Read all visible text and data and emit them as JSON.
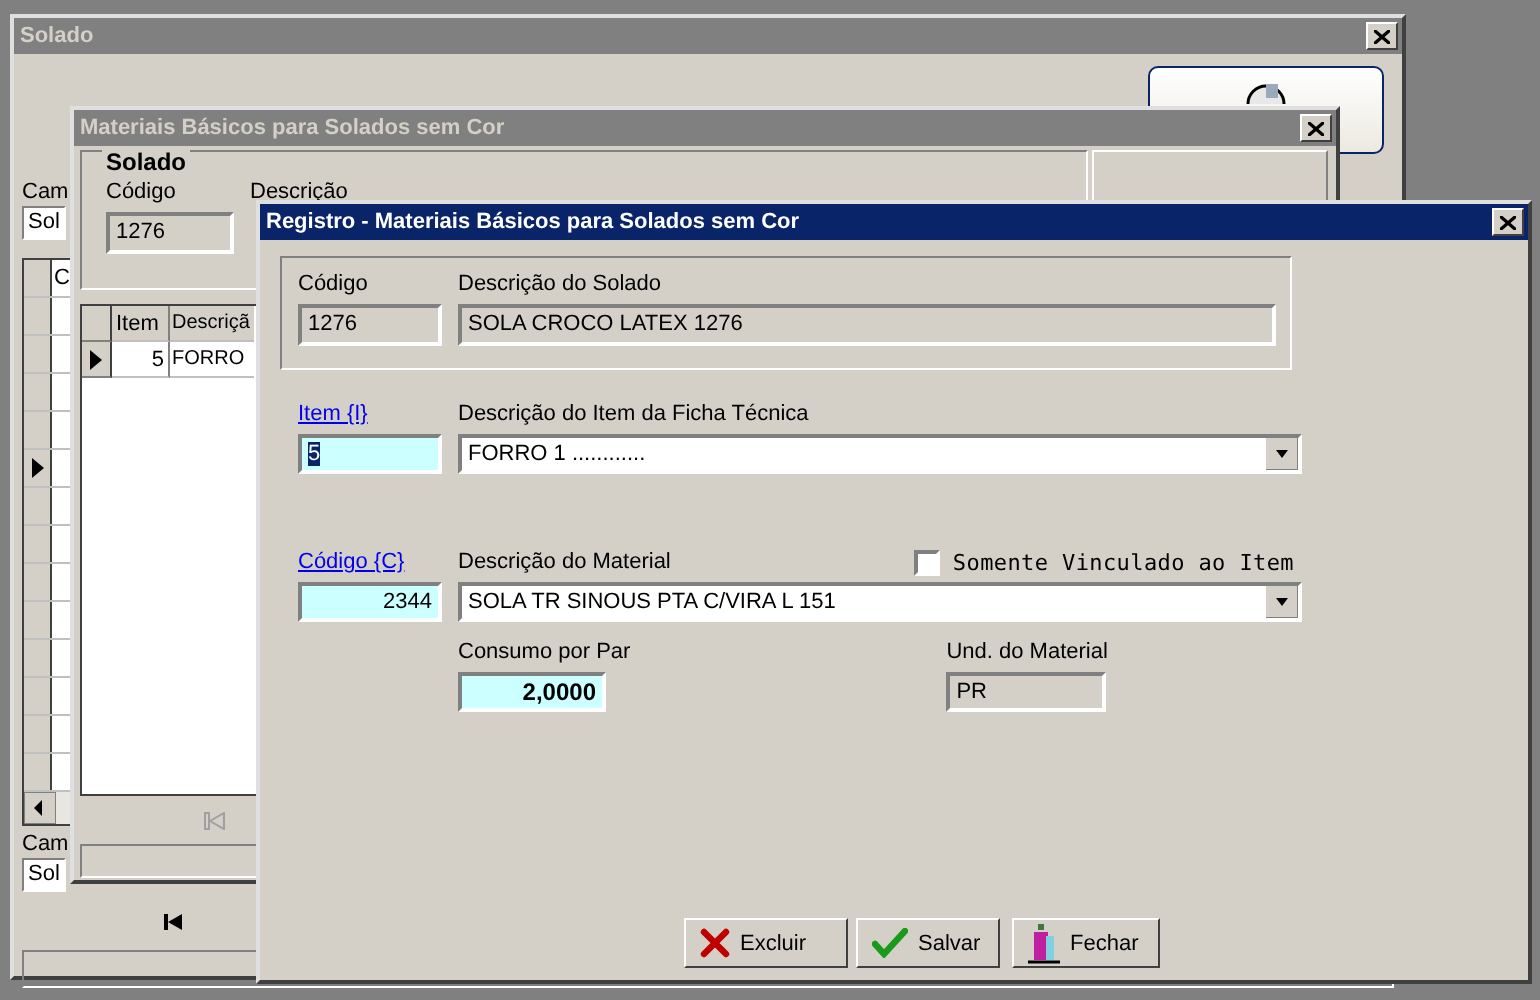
{
  "solado_window": {
    "title": "Solado",
    "active": false,
    "top_label": "Cam",
    "top_field": "Sol",
    "grid_heading": "C",
    "grid_rows": [
      {
        "selected": false
      },
      {
        "selected": false
      },
      {
        "selected": false
      },
      {
        "selected": false
      },
      {
        "selected": true
      },
      {
        "selected": false
      },
      {
        "selected": false
      },
      {
        "selected": false
      },
      {
        "selected": false
      },
      {
        "selected": false
      },
      {
        "selected": false
      },
      {
        "selected": false
      },
      {
        "selected": false
      }
    ],
    "bottom_label": "Cam",
    "bottom_field": "Sol"
  },
  "materiais_window": {
    "title": "Materiais Básicos para Solados sem Cor",
    "active": false,
    "group_title": "Solado",
    "code_label": "Código",
    "code_value": "1276",
    "description_label": "Descrição",
    "columns": [
      "Item",
      "Descriçã"
    ],
    "rows": [
      {
        "item": "5",
        "description": "FORRO",
        "selected": true
      }
    ]
  },
  "registro_window": {
    "title": "Registro - Materiais Básicos para Solados sem Cor",
    "active": true,
    "sole": {
      "code_label": "Código",
      "code_value": "1276",
      "description_label": "Descrição do Solado",
      "description_value": "SOLA CROCO LATEX 1276"
    },
    "item": {
      "link": "Item {I}",
      "value": "5",
      "value_selected": true,
      "description_label": "Descrição do Item da Ficha Técnica",
      "description_value": "FORRO 1 ............"
    },
    "material": {
      "link": "Código {C}",
      "value": "2344",
      "description_label": "Descrição do Material",
      "description_value": "SOLA TR SINOUS PTA C/VIRA L 151",
      "only_linked": {
        "label": "Somente Vinculado ao Item",
        "checked": false
      }
    },
    "consumption": {
      "label": "Consumo por Par",
      "value": "2,0000"
    },
    "unit": {
      "label": "Und. do Material",
      "value": "PR"
    },
    "buttons": [
      {
        "label": "Excluir",
        "kind": "delete"
      },
      {
        "label": "Salvar",
        "kind": "save"
      },
      {
        "label": "Fechar",
        "kind": "close"
      }
    ]
  }
}
